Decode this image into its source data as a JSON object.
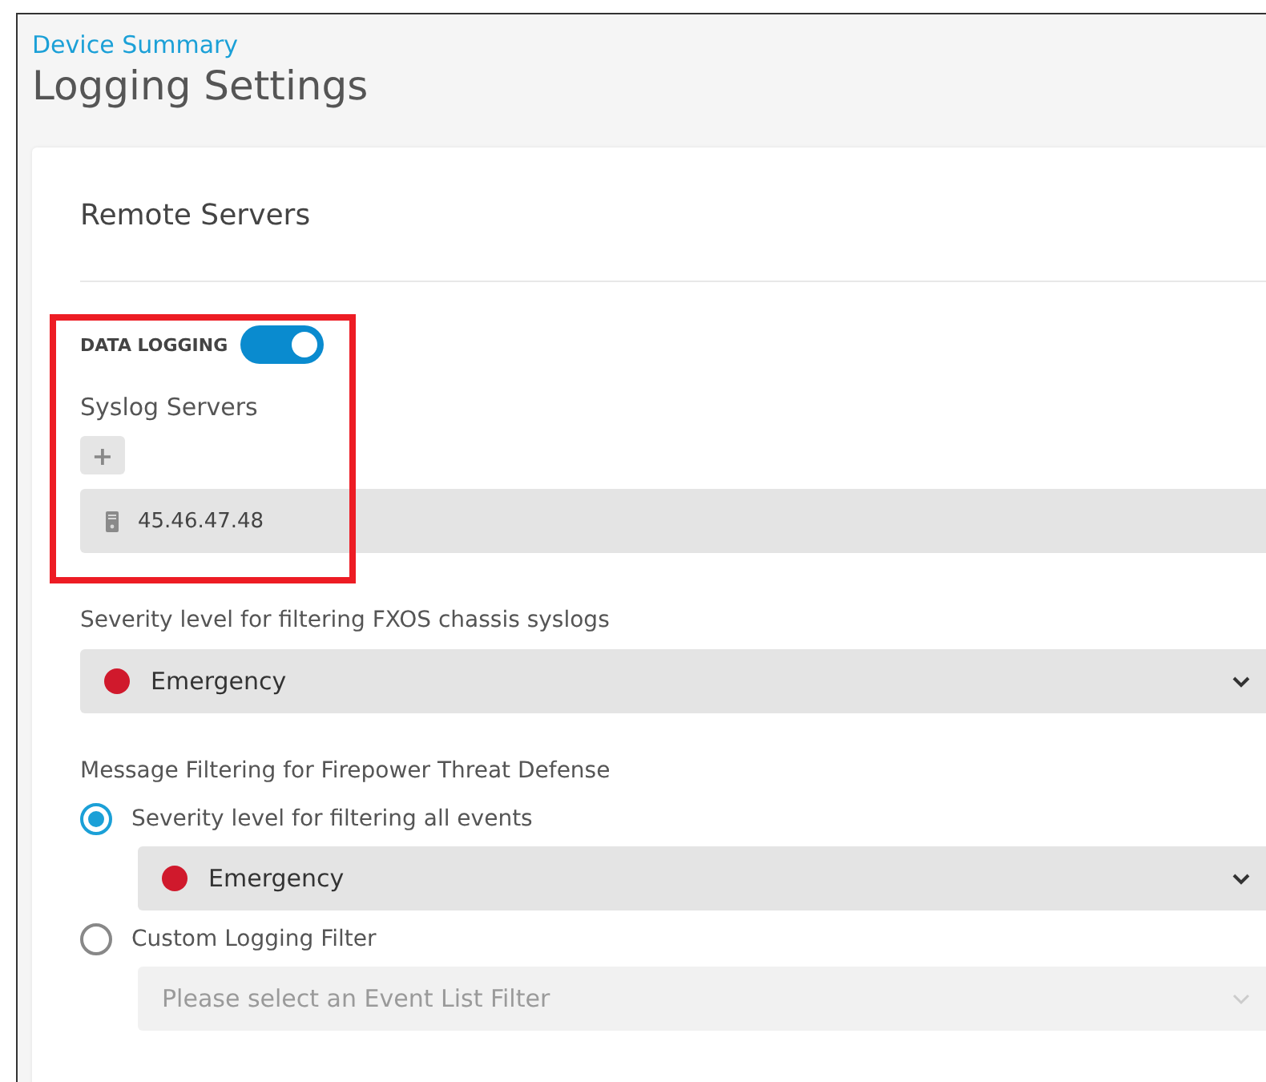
{
  "breadcrumb": "Device Summary",
  "title": "Logging Settings",
  "section": {
    "title": "Remote Servers"
  },
  "data_logging": {
    "label": "DATA LOGGING",
    "on": true
  },
  "syslog": {
    "label": "Syslog Servers",
    "add": "+",
    "servers": [
      "45.46.47.48"
    ]
  },
  "fxos": {
    "label": "Severity level for filtering FXOS chassis syslogs",
    "value": "Emergency",
    "color": "#d0192c"
  },
  "ftd": {
    "label": "Message Filtering for Firepower Threat Defense",
    "options": [
      {
        "label": "Severity level for filtering all events",
        "selected": true,
        "kind": "severity",
        "value": "Emergency",
        "color": "#d0192c",
        "disabled": false
      },
      {
        "label": "Custom Logging Filter",
        "selected": false,
        "kind": "filter",
        "placeholder": "Please select an Event List Filter",
        "disabled": true
      }
    ]
  }
}
